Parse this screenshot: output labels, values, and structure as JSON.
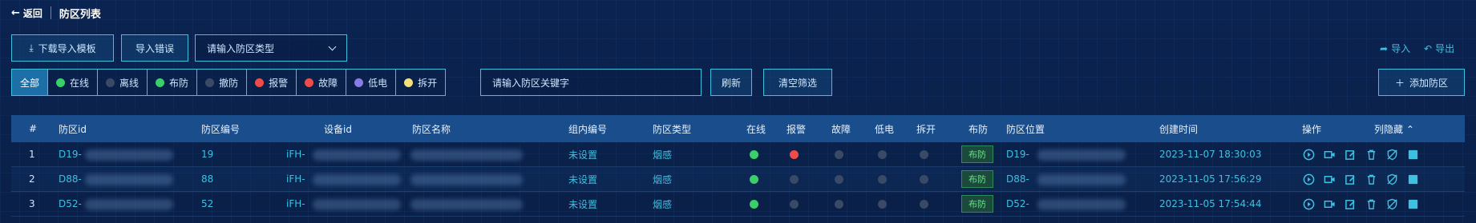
{
  "header": {
    "back_label": "返回",
    "title": "防区列表"
  },
  "toolbar": {
    "download_template": "下载导入模板",
    "import_error": "导入错误",
    "type_placeholder": "请输入防区类型",
    "import": "导入",
    "export": "导出"
  },
  "filters": [
    {
      "label": "全部",
      "color": "",
      "active": true
    },
    {
      "label": "在线",
      "color": "#39d06a"
    },
    {
      "label": "离线",
      "color": "#3a4a66"
    },
    {
      "label": "布防",
      "color": "#39d06a"
    },
    {
      "label": "撤防",
      "color": "#3a4a66"
    },
    {
      "label": "报警",
      "color": "#f04b4b"
    },
    {
      "label": "故障",
      "color": "#f04b4b"
    },
    {
      "label": "低电",
      "color": "#8a7ae6"
    },
    {
      "label": "拆开",
      "color": "#f5e07a"
    }
  ],
  "search": {
    "placeholder": "请输入防区关键字",
    "refresh": "刷新",
    "clear": "清空筛选",
    "add": "添加防区"
  },
  "table": {
    "headers": {
      "idx": "#",
      "zone_id": "防区id",
      "zone_no": "防区编号",
      "device_id": "设备id",
      "zone_name": "防区名称",
      "group_no": "组内编号",
      "zone_type": "防区类型",
      "online": "在线",
      "alarm": "报警",
      "fault": "故障",
      "lowbat": "低电",
      "opened": "拆开",
      "armed": "布防",
      "location": "防区位置",
      "created": "创建时间",
      "ops": "操作",
      "hide_cols": "列隐藏"
    },
    "rows": [
      {
        "idx": "1",
        "zone_id": "D19-",
        "zone_no": "19",
        "device_id": "iFH-",
        "zone_name": "",
        "group_no": "未设置",
        "zone_type": "烟感",
        "online": "#39d06a",
        "alarm": "#f04b4b",
        "fault": "#3a4a66",
        "lowbat": "#3a4a66",
        "opened": "#3a4a66",
        "armed": "布防",
        "location": "D19-",
        "created": "2023-11-07 18:30:03"
      },
      {
        "idx": "2",
        "zone_id": "D88-",
        "zone_no": "88",
        "device_id": "iFH-",
        "zone_name": "",
        "group_no": "未设置",
        "zone_type": "烟感",
        "online": "#39d06a",
        "alarm": "#3a4a66",
        "fault": "#3a4a66",
        "lowbat": "#3a4a66",
        "opened": "#3a4a66",
        "armed": "布防",
        "location": "D88-",
        "created": "2023-11-05 17:56:29"
      },
      {
        "idx": "3",
        "zone_id": "D52-",
        "zone_no": "52",
        "device_id": "iFH-",
        "zone_name": "",
        "group_no": "未设置",
        "zone_type": "烟感",
        "online": "#39d06a",
        "alarm": "#3a4a66",
        "fault": "#3a4a66",
        "lowbat": "#3a4a66",
        "opened": "#3a4a66",
        "armed": "布防",
        "location": "D52-",
        "created": "2023-11-05 17:54:44"
      }
    ]
  },
  "ops_icons": [
    "play-icon",
    "video-icon",
    "edit-icon",
    "delete-icon",
    "shield-icon",
    "stop-icon"
  ],
  "colors": {
    "accent": "#3ec0e0",
    "bg": "#0b2350"
  }
}
